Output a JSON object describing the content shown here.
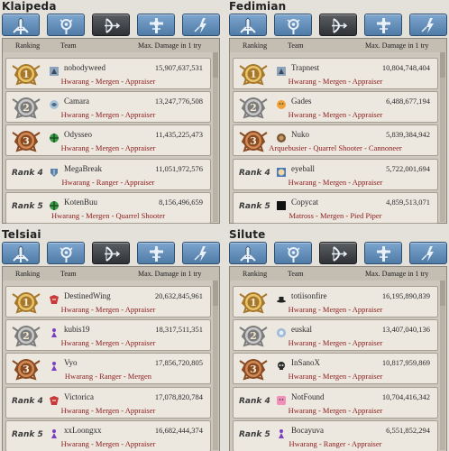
{
  "colors": {
    "background": "#e4e1da",
    "tab_blue": "#5b86b1",
    "tab_active": "#3a3d42",
    "job_text": "#8c1a1a",
    "row_bg": "#ece8e0",
    "gold_medal": "#c79a45",
    "silver_medal": "#9a9a9a",
    "bronze_medal": "#b3683a"
  },
  "tab_icons": [
    "swordsman-class-icon",
    "wizard-class-icon",
    "archer-class-icon",
    "cleric-class-icon",
    "scout-class-icon"
  ],
  "headers": {
    "ranking": "Ranking",
    "team": "Team",
    "damage": "Max. Damage in 1 try"
  },
  "panels": [
    {
      "server": "Klaipeda",
      "rows": [
        {
          "rank_label": "1",
          "emblem": "wolf-emblem-icon",
          "team": "nobodyweed",
          "damage": "15,907,637,531",
          "jobs": "Hwarang - Mergen - Appraiser"
        },
        {
          "rank_label": "2",
          "emblem": "swirl-emblem-icon",
          "team": "Camara",
          "damage": "13,247,776,508",
          "jobs": "Hwarang - Mergen - Appraiser"
        },
        {
          "rank_label": "3",
          "emblem": "green-cross-emblem-icon",
          "team": "Odysseo",
          "damage": "11,435,225,473",
          "jobs": "Hwarang - Mergen - Appraiser"
        },
        {
          "rank_label": "Rank 4",
          "emblem": "shield-emblem-icon",
          "team": "MegaBreak",
          "damage": "11,051,972,576",
          "jobs": "Hwarang - Ranger - Appraiser"
        },
        {
          "rank_label": "Rank 5",
          "emblem": "green-cross-emblem-icon",
          "team": "KotenBuu",
          "damage": "8,156,496,659",
          "jobs": "Hwarang - Mergen - Quarrel Shooter"
        }
      ]
    },
    {
      "server": "Fedimian",
      "rows": [
        {
          "rank_label": "1",
          "emblem": "wolf-emblem-icon",
          "team": "Trapnest",
          "damage": "10,804,748,404",
          "jobs": "Hwarang - Mergen - Appraiser"
        },
        {
          "rank_label": "2",
          "emblem": "orange-face-emblem-icon",
          "team": "Gades",
          "damage": "6,488,677,194",
          "jobs": "Hwarang - Mergen - Appraiser"
        },
        {
          "rank_label": "3",
          "emblem": "brown-emblem-icon",
          "team": "Nuko",
          "damage": "5,839,384,942",
          "jobs": "Arquebusier - Quarrel Shooter - Cannoneer"
        },
        {
          "rank_label": "Rank 4",
          "emblem": "face-emblem-icon",
          "team": "eyeball",
          "damage": "5,722,001,694",
          "jobs": "Hwarang - Mergen - Appraiser"
        },
        {
          "rank_label": "Rank 5",
          "emblem": "moon-emblem-icon",
          "team": "Copycat",
          "damage": "4,859,513,071",
          "jobs": "Matross - Mergen - Pied Piper"
        }
      ]
    },
    {
      "server": "Telsiai",
      "rows": [
        {
          "rank_label": "1",
          "emblem": "red-wolf-emblem-icon",
          "team": "DestinedWing",
          "damage": "20,632,845,961",
          "jobs": "Hwarang - Mergen - Appraiser"
        },
        {
          "rank_label": "2",
          "emblem": "purple-figure-emblem-icon",
          "team": "kubis19",
          "damage": "18,317,511,351",
          "jobs": "Hwarang - Mergen - Appraiser"
        },
        {
          "rank_label": "3",
          "emblem": "purple-figure-emblem-icon",
          "team": "Vyo",
          "damage": "17,856,720,805",
          "jobs": "Hwarang - Ranger - Mergen"
        },
        {
          "rank_label": "Rank 4",
          "emblem": "red-wolf-emblem-icon",
          "team": "Victorica",
          "damage": "17,078,820,784",
          "jobs": "Hwarang - Mergen - Appraiser"
        },
        {
          "rank_label": "Rank 5",
          "emblem": "purple-figure-emblem-icon",
          "team": "xxLoongxx",
          "damage": "16,682,444,374",
          "jobs": "Hwarang - Mergen - Appraiser"
        }
      ]
    },
    {
      "server": "Silute",
      "rows": [
        {
          "rank_label": "1",
          "emblem": "hat-emblem-icon",
          "team": "totiisonfire",
          "damage": "16,195,890,839",
          "jobs": "Hwarang - Mergen - Appraiser"
        },
        {
          "rank_label": "2",
          "emblem": "blue-face-emblem-icon",
          "team": "euskal",
          "damage": "13,407,040,136",
          "jobs": "Hwarang - Mergen - Appraiser"
        },
        {
          "rank_label": "3",
          "emblem": "skull-emblem-icon",
          "team": "InSanoX",
          "damage": "10,817,959,869",
          "jobs": "Hwarang - Mergen - Appraiser"
        },
        {
          "rank_label": "Rank 4",
          "emblem": "pink-face-emblem-icon",
          "team": "NotFound",
          "damage": "10,704,416,342",
          "jobs": "Hwarang - Mergen - Appraiser"
        },
        {
          "rank_label": "Rank 5",
          "emblem": "purple-figure-emblem-icon",
          "team": "Bocayuva",
          "damage": "6,551,852,294",
          "jobs": "Hwarang - Ranger - Appraiser"
        }
      ]
    }
  ]
}
